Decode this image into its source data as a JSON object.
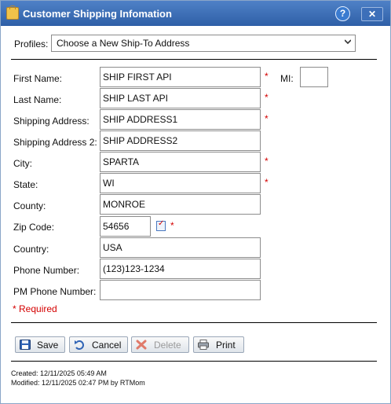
{
  "window": {
    "title": "Customer Shipping Infomation",
    "help_icon": "help-icon",
    "close_icon": "close-icon"
  },
  "profiles": {
    "label": "Profiles:",
    "selected": "Choose a New Ship-To Address"
  },
  "fields": {
    "first_name": {
      "label": "First Name:",
      "value": "SHIP FIRST API"
    },
    "mi": {
      "label": "MI:",
      "value": ""
    },
    "last_name": {
      "label": "Last Name:",
      "value": "SHIP LAST API"
    },
    "address1": {
      "label": "Shipping Address:",
      "value": "SHIP ADDRESS1"
    },
    "address2": {
      "label": "Shipping Address 2:",
      "value": "SHIP ADDRESS2"
    },
    "city": {
      "label": "City:",
      "value": "SPARTA"
    },
    "state": {
      "label": "State:",
      "value": "WI"
    },
    "county": {
      "label": "County:",
      "value": "MONROE"
    },
    "zip": {
      "label": "Zip Code:",
      "value": "54656"
    },
    "country": {
      "label": "Country:",
      "value": "USA"
    },
    "phone": {
      "label": "Phone Number:",
      "value": "(123)123-1234"
    },
    "pm_phone": {
      "label": "PM Phone Number:",
      "value": ""
    }
  },
  "required_marker": "*",
  "required_note": "* Required",
  "buttons": {
    "save": "Save",
    "cancel": "Cancel",
    "delete": "Delete",
    "print": "Print"
  },
  "meta": {
    "created": "Created: 12/11/2025 05:49 AM",
    "modified": "Modified: 12/11/2025 02:47 PM by RTMom"
  },
  "colors": {
    "titlebar": "#3a6db8",
    "required": "#d40000"
  }
}
